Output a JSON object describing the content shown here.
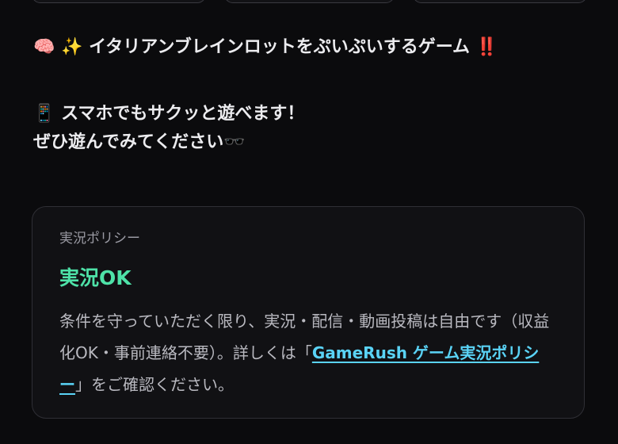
{
  "description": {
    "line1": {
      "emoji": "🧠 ✨",
      "text": "イタリアンブレインロットをぷいぷいするゲーム",
      "trail_emoji": "‼️"
    },
    "line2": {
      "emoji": "📱",
      "text": "スマホでもサクッと遊べます！"
    },
    "line3": {
      "text": "ぜひ遊んでみてください",
      "trail_emoji": "🕶️"
    }
  },
  "policy": {
    "label": "実況ポリシー",
    "status": "実況OK",
    "status_color": "#4ee2a8",
    "body_before": "条件を守っていただく限り、実況・配信・動画投稿は自由です（収益化OK・事前連絡不要）。詳しくは「",
    "link_text": "GameRush ゲーム実況ポリシー",
    "link_color": "#5ad3f6",
    "body_after": "」をご確認ください。"
  }
}
